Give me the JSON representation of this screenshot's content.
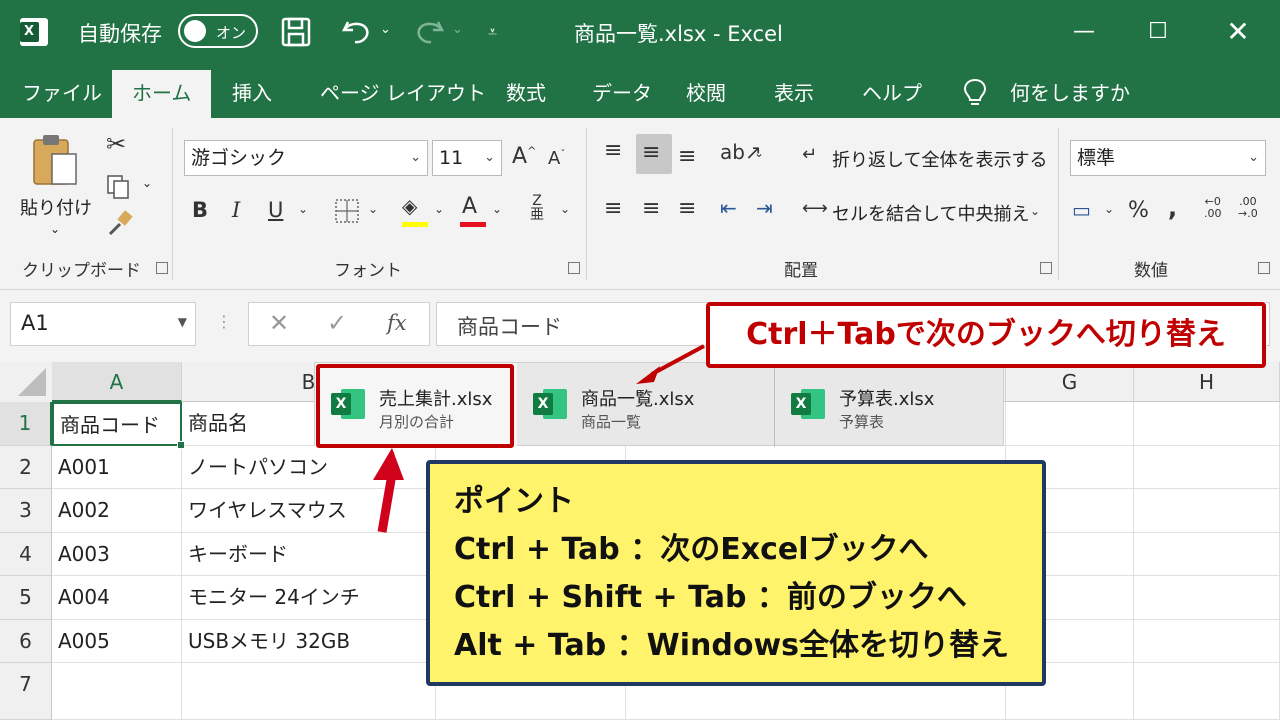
{
  "titlebar": {
    "logo": "X",
    "autosave_label": "自動保存",
    "toggle_state": "オン",
    "title": "商品一覧.xlsx  -  Excel",
    "icons": [
      "save-icon",
      "undo-icon",
      "redo-icon",
      "customize-icon"
    ]
  },
  "tabs": [
    "ファイル",
    "ホーム",
    "挿入",
    "ページ レイアウト",
    "数式",
    "データ",
    "校閲",
    "表示",
    "ヘルプ"
  ],
  "active_tab": "ホーム",
  "tell_me": "何をしますか",
  "ribbon": {
    "clipboard": {
      "paste": "貼り付け",
      "label": "クリップボード"
    },
    "font": {
      "name": "游ゴシック",
      "size": "11",
      "label": "フォント",
      "font_color": "#e81123",
      "highlight_color": "#ffff00"
    },
    "alignment": {
      "wrap": "折り返して全体を表示する",
      "merge": "セルを結合して中央揃え",
      "label": "配置"
    },
    "number": {
      "format": "標準",
      "label": "数値"
    }
  },
  "formula_bar": {
    "name_box": "A1",
    "fx": "fx",
    "content": "商品コード"
  },
  "columns": [
    "A",
    "B",
    "H"
  ],
  "rows": [
    {
      "num": "1",
      "a": "商品コード",
      "b": "商品名"
    },
    {
      "num": "2",
      "a": "A001",
      "b": "ノートパソコン"
    },
    {
      "num": "3",
      "a": "A002",
      "b": "ワイヤレスマウス"
    },
    {
      "num": "4",
      "a": "A003",
      "b": "キーボード"
    },
    {
      "num": "5",
      "a": "A004",
      "b": "モニター 24インチ"
    },
    {
      "num": "6",
      "a": "A005",
      "b": "USBメモリ 32GB"
    },
    {
      "num": "7",
      "a": "",
      "b": ""
    }
  ],
  "column_g": "G",
  "switcher": [
    {
      "name": "売上集計.xlsx",
      "sub": "月別の合計"
    },
    {
      "name": "商品一覧.xlsx",
      "sub": "商品一覧"
    },
    {
      "name": "予算表.xlsx",
      "sub": "予算表"
    }
  ],
  "callout": "Ctrl＋Tabで次のブックへ切り替え",
  "tip": {
    "title": "ポイント",
    "lines": [
      "Ctrl + Tab ：次のExcelブックへ",
      "Ctrl + Shift + Tab ：前のブックへ",
      "Alt + Tab ：Windows全体を切り替え"
    ]
  },
  "colors": {
    "excel_green": "#217346",
    "callout_red": "#c00000",
    "tip_yellow": "#fff36b",
    "tip_border": "#1f3864"
  }
}
